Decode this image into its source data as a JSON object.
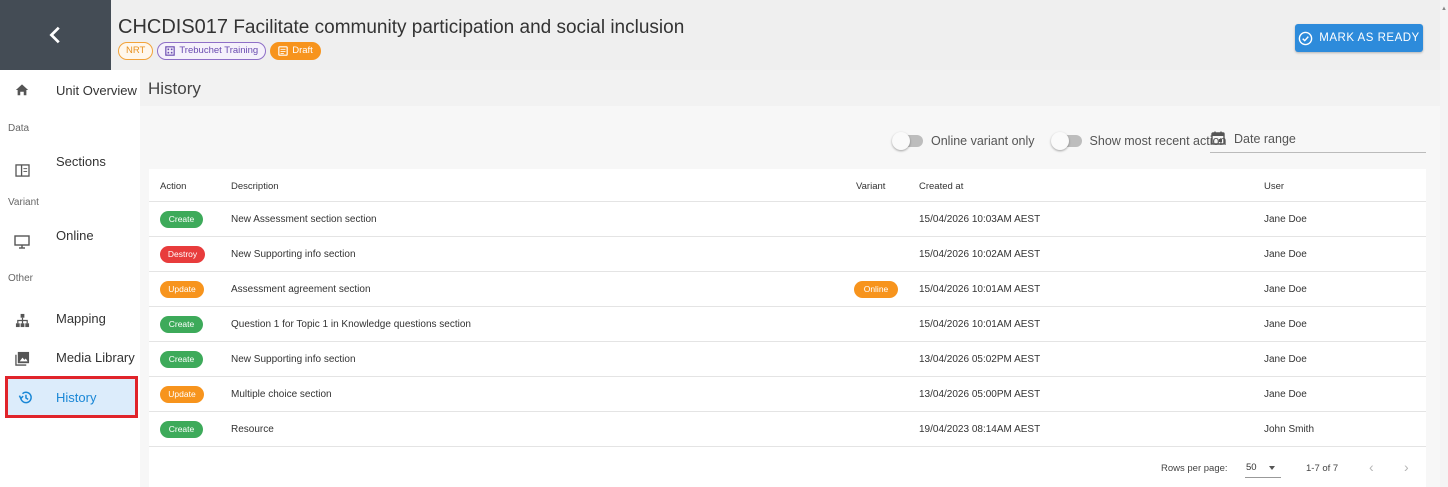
{
  "header": {
    "unit_code": "CHCDIS017",
    "unit_title": "Facilitate community participation and social inclusion",
    "chips": {
      "nrt": "NRT",
      "organisation": "Trebuchet Training",
      "status": "Draft"
    },
    "mark_ready_label": "MARK AS READY"
  },
  "sidebar": {
    "unit_overview": "Unit Overview",
    "group_data": "Data",
    "sections": "Sections",
    "group_variant": "Variant",
    "online": "Online",
    "group_other": "Other",
    "mapping": "Mapping",
    "media_library": "Media Library",
    "history": "History"
  },
  "page": {
    "title": "History",
    "filters": {
      "online_variant_only": "Online variant only",
      "show_most_recent_action": "Show most recent action",
      "date_range_placeholder": "Date range"
    }
  },
  "table": {
    "columns": [
      "Action",
      "Description",
      "Variant",
      "Created at",
      "User"
    ],
    "rows": [
      {
        "action": "Create",
        "description": "New Assessment section section",
        "variant": "",
        "created_at": "15/04/2026 10:03AM AEST",
        "user": "Jane Doe"
      },
      {
        "action": "Destroy",
        "description": "New Supporting info section",
        "variant": "",
        "created_at": "15/04/2026 10:02AM AEST",
        "user": "Jane Doe"
      },
      {
        "action": "Update",
        "description": "Assessment agreement section",
        "variant": "Online",
        "created_at": "15/04/2026 10:01AM AEST",
        "user": "Jane Doe"
      },
      {
        "action": "Create",
        "description": "Question 1 for Topic 1 in Knowledge questions section",
        "variant": "",
        "created_at": "15/04/2026 10:01AM AEST",
        "user": "Jane Doe"
      },
      {
        "action": "Create",
        "description": "New Supporting info section",
        "variant": "",
        "created_at": "13/04/2026 05:02PM AEST",
        "user": "Jane Doe"
      },
      {
        "action": "Update",
        "description": "Multiple choice section",
        "variant": "",
        "created_at": "13/04/2026 05:00PM AEST",
        "user": "Jane Doe"
      },
      {
        "action": "Create",
        "description": "Resource",
        "variant": "",
        "created_at": "19/04/2023 08:14AM AEST",
        "user": "John Smith"
      }
    ],
    "pagination": {
      "rows_per_page_label": "Rows per page:",
      "rows_per_page_value": "50",
      "range_text": "1-7 of 7"
    }
  },
  "colors": {
    "create": "#3daa5a",
    "destroy": "#e83c3c",
    "update": "#f7941d",
    "accent": "#2d8bdb",
    "highlight_border": "#e0242b"
  }
}
